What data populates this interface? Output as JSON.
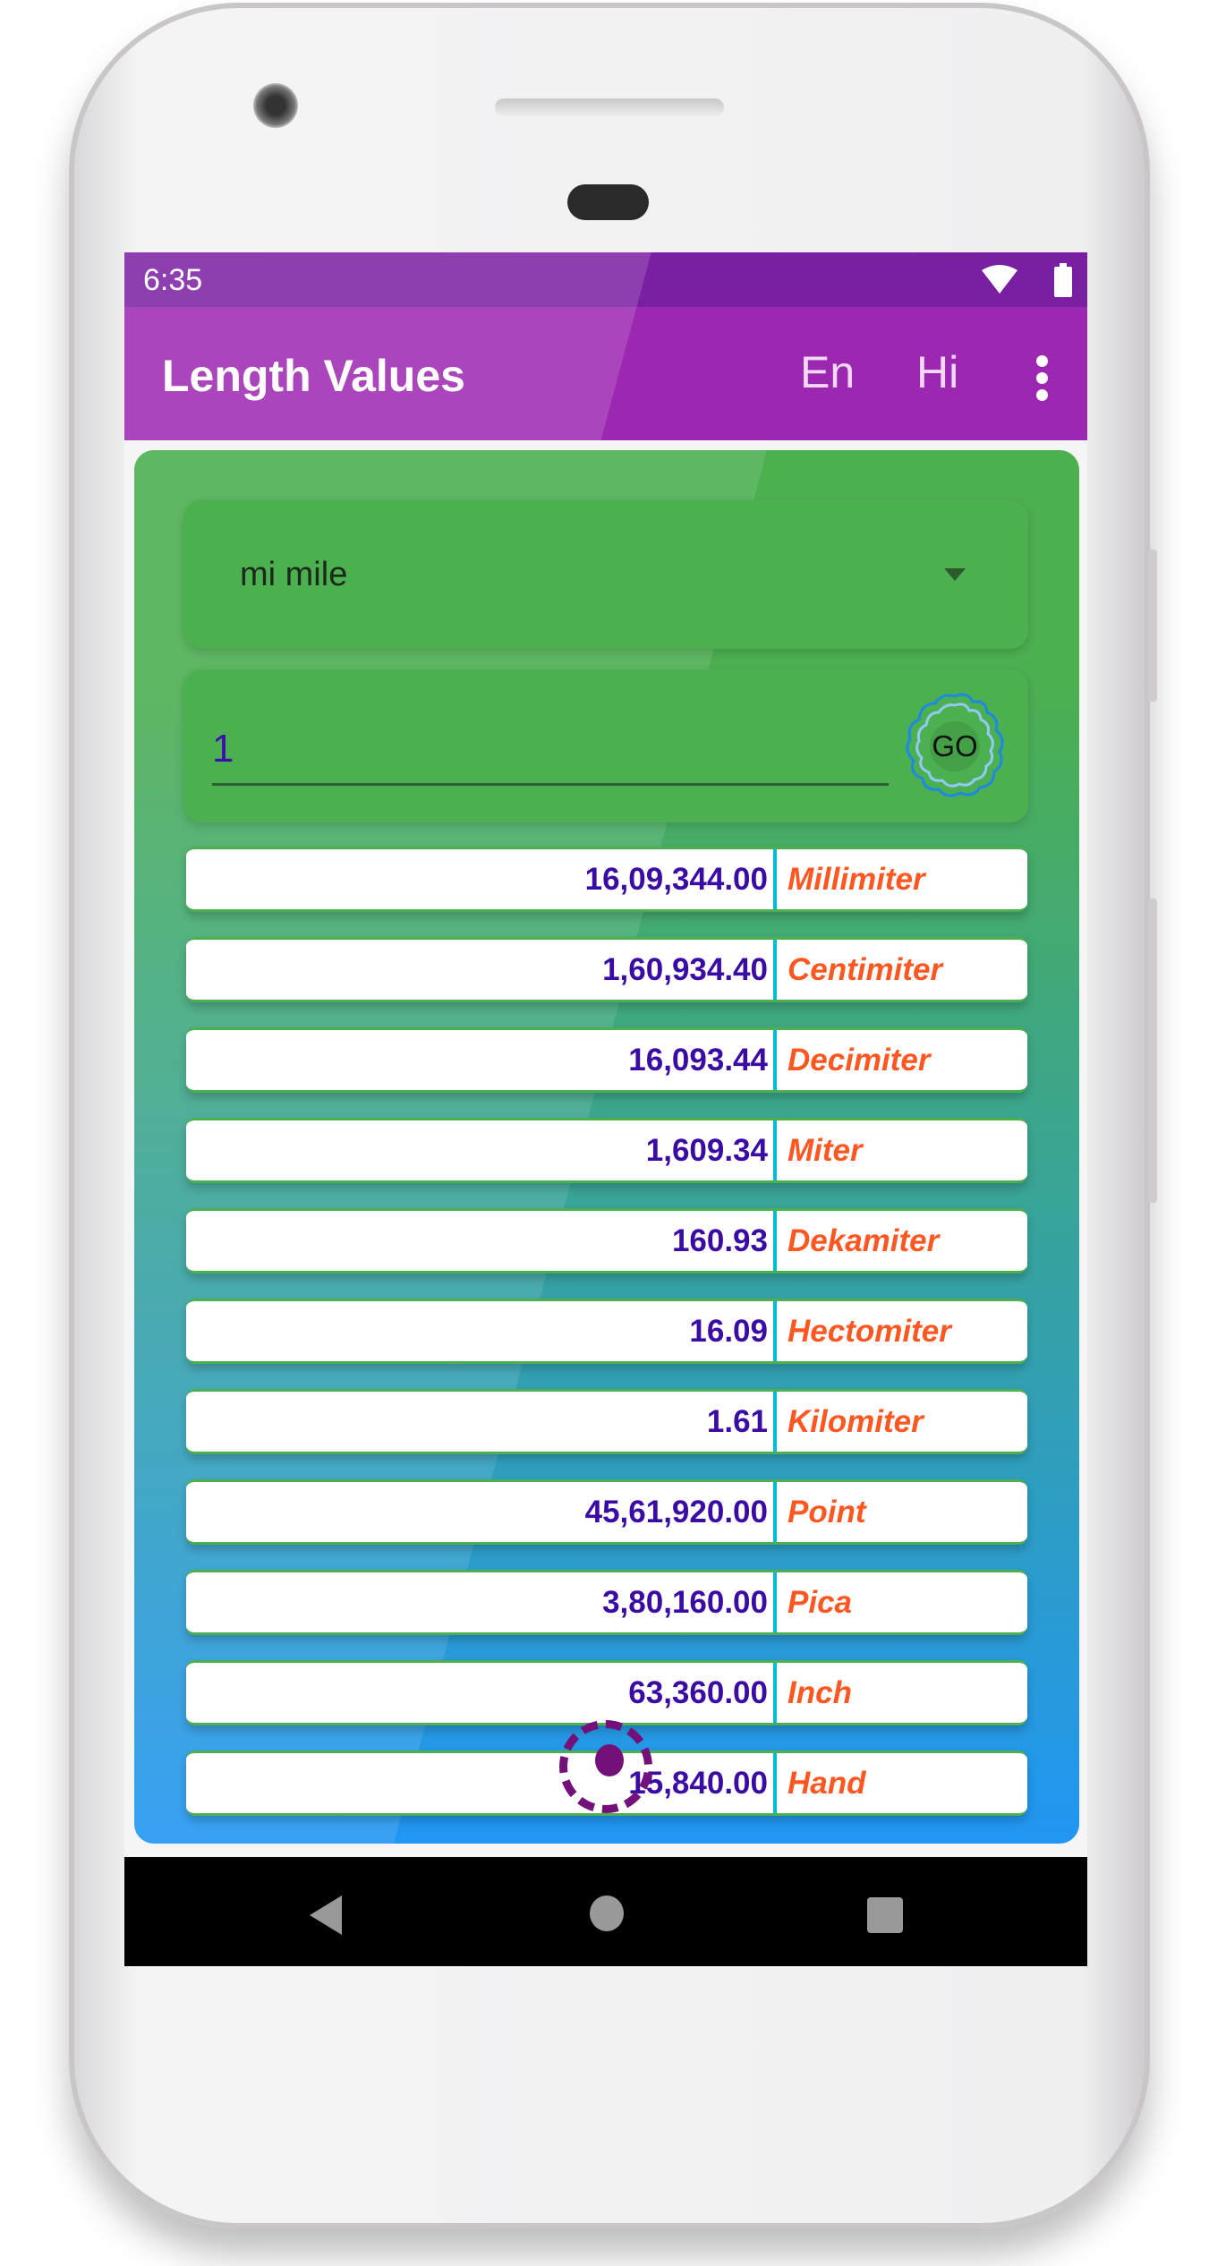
{
  "status_bar": {
    "time": "6:35",
    "icons": [
      "wifi-icon",
      "battery-icon"
    ]
  },
  "app_bar": {
    "title": "Length Values",
    "lang_en": "En",
    "lang_hi": "Hi",
    "menu_icon": "more-vertical-icon"
  },
  "unit_select": {
    "selected": "mi mile"
  },
  "input": {
    "value": "1",
    "go_label": "GO"
  },
  "results": [
    {
      "value": "16,09,344.00",
      "unit": "Millimiter"
    },
    {
      "value": "1,60,934.40",
      "unit": "Centimiter"
    },
    {
      "value": "16,093.44",
      "unit": "Decimiter"
    },
    {
      "value": "1,609.34",
      "unit": "Miter"
    },
    {
      "value": "160.93",
      "unit": "Dekamiter"
    },
    {
      "value": "16.09",
      "unit": "Hectomiter"
    },
    {
      "value": "1.61",
      "unit": "Kilomiter"
    },
    {
      "value": "45,61,920.00",
      "unit": "Point"
    },
    {
      "value": "3,80,160.00",
      "unit": "Pica"
    },
    {
      "value": "63,360.00",
      "unit": "Inch"
    },
    {
      "value": "15,840.00",
      "unit": "Hand"
    }
  ],
  "colors": {
    "status_bar": "#7b1fa2",
    "app_bar": "#9c27b0",
    "card_top": "#4caf50",
    "card_bottom": "#2196f3",
    "value_text": "#3a0ca3",
    "unit_text": "#ff5722",
    "divider": "#00bcd4"
  }
}
